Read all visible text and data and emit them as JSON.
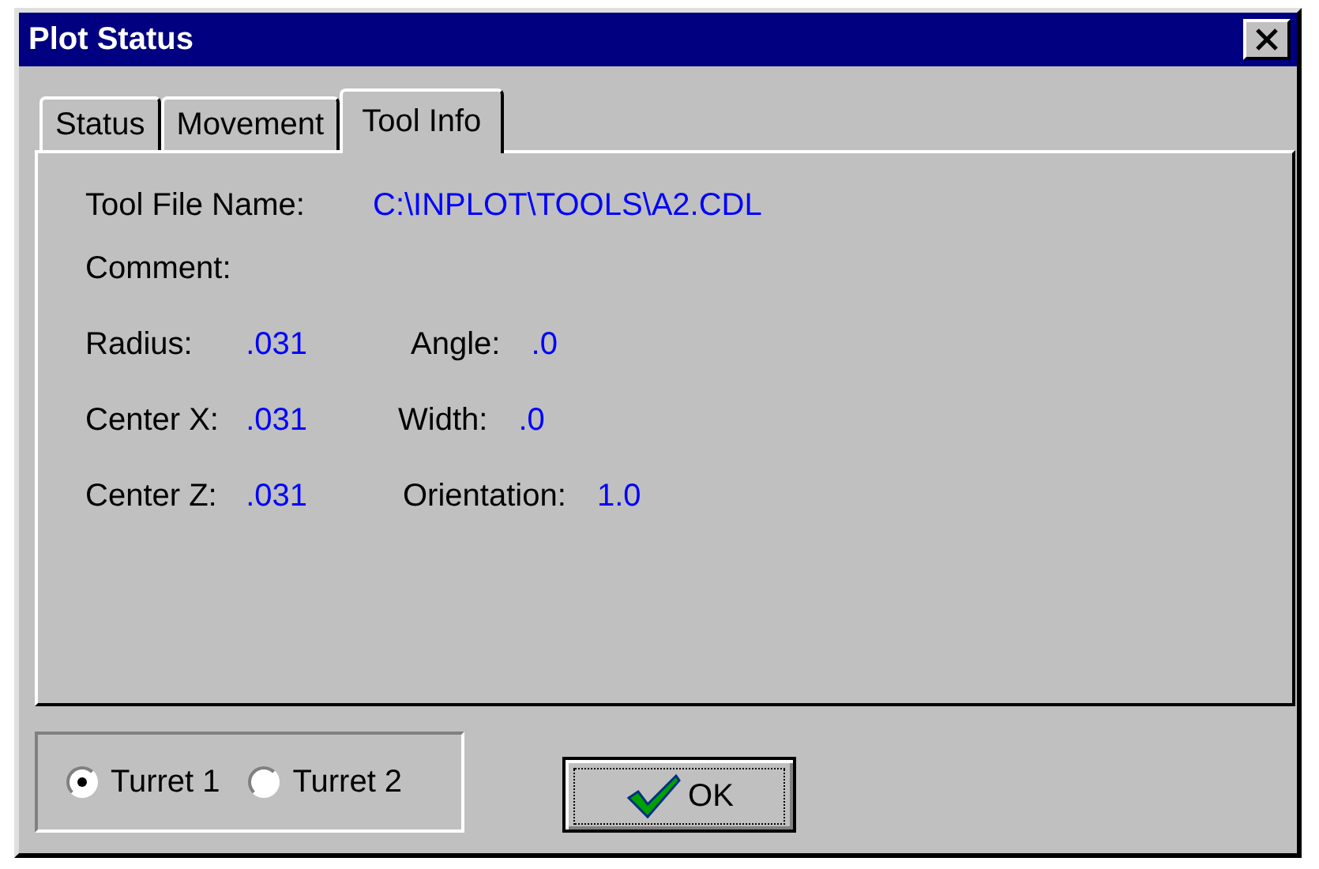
{
  "window": {
    "title": "Plot Status"
  },
  "tabs": [
    {
      "label": "Status",
      "selected": false
    },
    {
      "label": "Movement",
      "selected": false
    },
    {
      "label": "Tool Info",
      "selected": true
    }
  ],
  "tool_file": {
    "label": "Tool File Name:",
    "value": "C:\\INPLOT\\TOOLS\\A2.CDL"
  },
  "comment": {
    "label": "Comment:"
  },
  "rows": [
    {
      "left": {
        "label": "Radius:",
        "value": ".031"
      },
      "right": {
        "label": "Angle:",
        "value": ".0"
      }
    },
    {
      "left": {
        "label": "Center X:",
        "value": ".031"
      },
      "right": {
        "label": "Width:",
        "value": ".0"
      }
    },
    {
      "left": {
        "label": "Center Z:",
        "value": ".031"
      },
      "right": {
        "label": "Orientation:",
        "value": "1.0"
      }
    }
  ],
  "turrets": [
    {
      "label": "Turret 1",
      "selected": true
    },
    {
      "label": "Turret 2",
      "selected": false
    }
  ],
  "ok_button": {
    "label": "OK"
  }
}
